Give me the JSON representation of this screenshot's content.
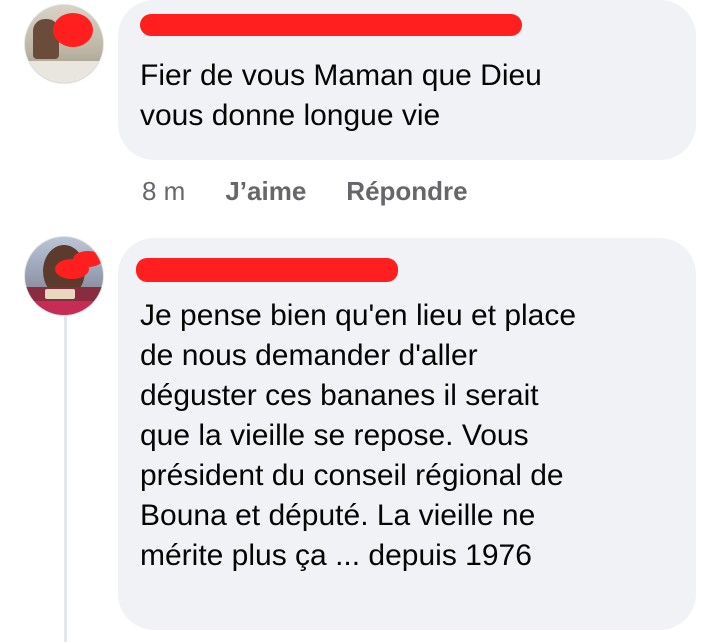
{
  "comments": [
    {
      "author_name": "",
      "text": "Fier de vous Maman que Dieu\nvous donne longue vie",
      "time": "8 m",
      "like_label": "J’aime",
      "reply_label": "Répondre"
    },
    {
      "author_name": "",
      "text": "Je pense bien qu'en lieu et place\nde nous demander d'aller\ndéguster ces bananes il serait\nque la vieille se repose. Vous\nprésident du conseil régional de\nBouna et député. La vieille ne\nmérite plus ça ... depuis 1976"
    }
  ],
  "colors": {
    "bubble": "#f0f2f5",
    "redaction": "#ff1f1f",
    "meta_text": "#65676b",
    "body_text": "#050505"
  }
}
